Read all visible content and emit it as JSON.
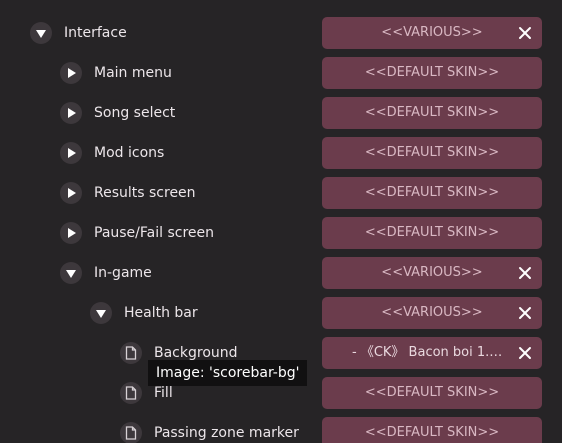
{
  "rows": [
    {
      "label": "Interface",
      "value": "<<VARIOUS>>",
      "expanded": true,
      "icon": "chevron-down-icon"
    },
    {
      "label": "Main menu",
      "value": "<<DEFAULT SKIN>>",
      "expanded": false,
      "icon": "chevron-right-icon"
    },
    {
      "label": "Song select",
      "value": "<<DEFAULT SKIN>>",
      "expanded": false,
      "icon": "chevron-right-icon"
    },
    {
      "label": "Mod icons",
      "value": "<<DEFAULT SKIN>>",
      "expanded": false,
      "icon": "chevron-right-icon"
    },
    {
      "label": "Results screen",
      "value": "<<DEFAULT SKIN>>",
      "expanded": false,
      "icon": "chevron-right-icon"
    },
    {
      "label": "Pause/Fail screen",
      "value": "<<DEFAULT SKIN>>",
      "expanded": false,
      "icon": "chevron-right-icon"
    },
    {
      "label": "In-game",
      "value": "<<VARIOUS>>",
      "expanded": true,
      "icon": "chevron-down-icon"
    },
    {
      "label": "Health bar",
      "value": "<<VARIOUS>>",
      "expanded": true,
      "icon": "chevron-down-icon"
    },
    {
      "label": "Background",
      "value": "- 《CK》 Bacon boi 1.0 『b...",
      "icon": "file-icon"
    },
    {
      "label": "Fill",
      "value": "<<DEFAULT SKIN>>",
      "icon": "file-icon"
    },
    {
      "label": "Passing zone marker",
      "value": "<<DEFAULT SKIN>>",
      "icon": "file-icon"
    }
  ],
  "tooltip": {
    "text": "Image:  'scorebar-bg'"
  },
  "colors": {
    "background": "#262426",
    "dropdown": "#6b3c4c",
    "dropdown_text": "#d9b8c3",
    "toggle": "#3d383c",
    "tooltip_bg": "#111011"
  }
}
